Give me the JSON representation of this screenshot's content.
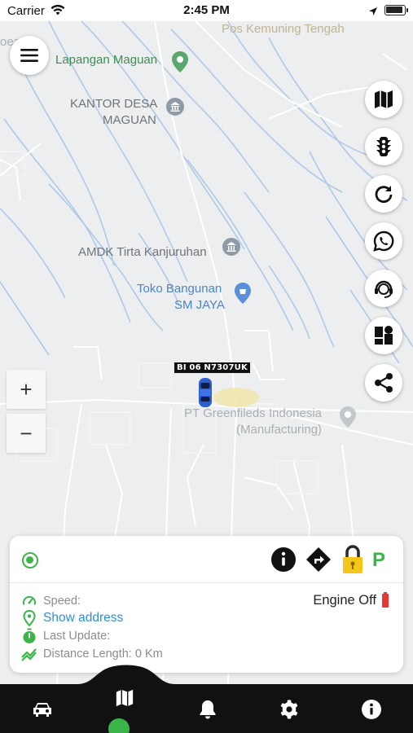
{
  "status_bar": {
    "carrier": "Carrier",
    "time": "2:45 PM"
  },
  "map": {
    "pois": [
      {
        "key": "pos_kemuning",
        "label": "Pos Kemuning Tengah"
      },
      {
        "key": "lapangan",
        "label": "Lapangan Maguan"
      },
      {
        "key": "kantor_line1",
        "label": "KANTOR DESA"
      },
      {
        "key": "kantor_line2",
        "label": "MAGUAN"
      },
      {
        "key": "amdk",
        "label": "AMDK Tirta Kanjuruhan"
      },
      {
        "key": "toko_line1",
        "label": "Toko Bangunan"
      },
      {
        "key": "toko_line2",
        "label": "SM JAYA"
      },
      {
        "key": "pt_line1",
        "label": "PT Greenfileds Indonesia"
      },
      {
        "key": "pt_line2",
        "label": "(Manufacturing)"
      },
      {
        "key": "edge_left",
        "label": "oea"
      }
    ],
    "vehicle_plate": "BI 06 N7307UK",
    "zoom_in": "+",
    "zoom_out": "−",
    "side_buttons": [
      "map-icon",
      "traffic-light-icon",
      "refresh-icon",
      "whatsapp-icon",
      "support-agent-icon",
      "dashboard-icon",
      "share-icon"
    ]
  },
  "card": {
    "speed_label": "Speed:",
    "address_link": "Show address",
    "last_update_label": "Last Update:",
    "distance_label": "Distance Length: 0 Km",
    "engine_status": "Engine Off",
    "parking": "P",
    "colors": {
      "status_green": "#3bb54a",
      "link_blue": "#2f8fd6",
      "lock_yellow": "#f5c518",
      "battery_red": "#e53935"
    }
  },
  "bottom_nav": {
    "items": [
      "car-icon",
      "map-icon",
      "bell-icon",
      "gear-icon",
      "info-icon"
    ],
    "active": "map-icon"
  }
}
